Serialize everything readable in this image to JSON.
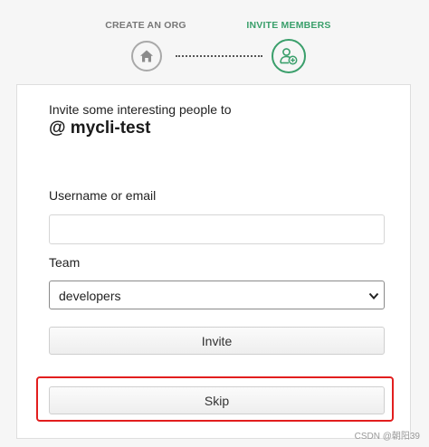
{
  "steps": [
    {
      "label": "CREATE AN ORG",
      "icon": "home-icon",
      "state": "done"
    },
    {
      "label": "INVITE MEMBERS",
      "icon": "add-user-icon",
      "state": "active"
    }
  ],
  "colors": {
    "accent": "#3a9f6b",
    "inactive": "#a9a9a9",
    "highlight": "#e21e1e"
  },
  "form": {
    "intro": "Invite some interesting people to",
    "org_name": "@ mycli-test",
    "username_label": "Username or email",
    "username_value": "",
    "username_placeholder": "",
    "team_label": "Team",
    "team_selected": "developers",
    "invite_label": "Invite",
    "skip_label": "Skip"
  },
  "watermark": "CSDN @朝阳39"
}
